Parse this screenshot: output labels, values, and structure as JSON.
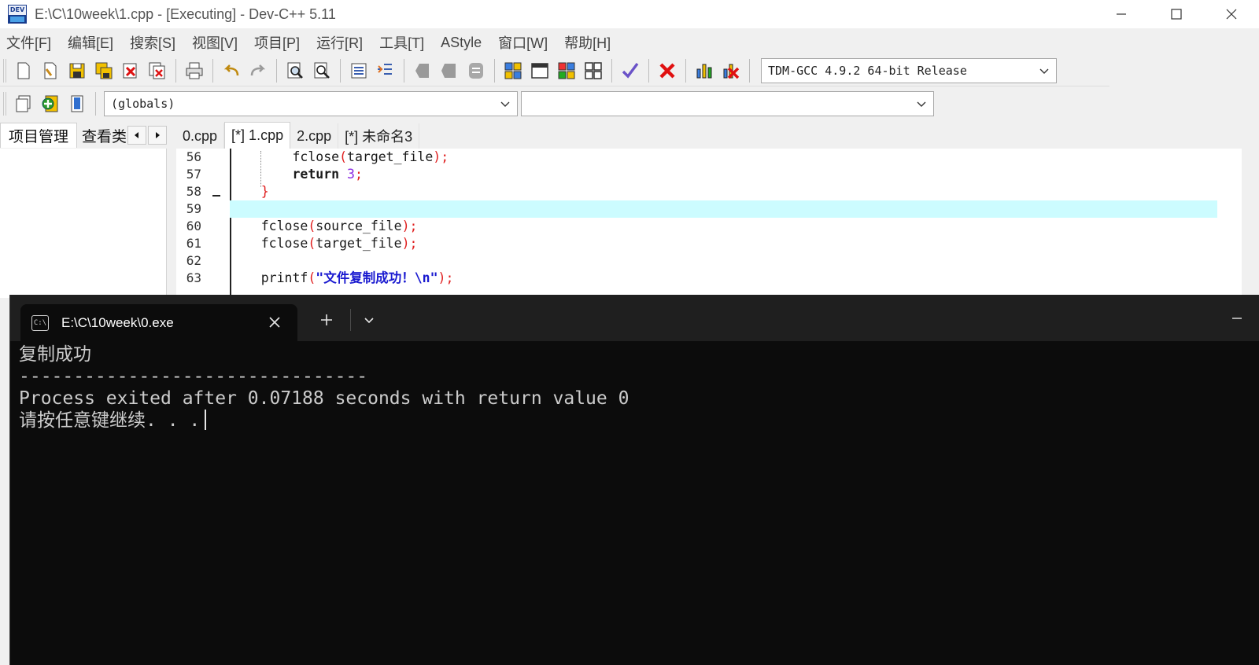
{
  "window": {
    "title": "E:\\C\\10week\\1.cpp - [Executing] - Dev-C++ 5.11",
    "icon_text": "DEV"
  },
  "menu": [
    "文件[F]",
    "编辑[E]",
    "搜索[S]",
    "视图[V]",
    "项目[P]",
    "运行[R]",
    "工具[T]",
    "AStyle",
    "窗口[W]",
    "帮助[H]"
  ],
  "toolbar": {
    "compiler": "TDM-GCC 4.9.2 64-bit Release",
    "globals": "(globals)",
    "members": ""
  },
  "left_panel": {
    "tabs": [
      "项目管理",
      "查看类"
    ]
  },
  "editor": {
    "tabs": [
      "0.cpp",
      "[*] 1.cpp",
      "2.cpp",
      "[*] 未命名3"
    ],
    "active_tab": 1,
    "lines": [
      {
        "n": "56",
        "text": "        fclose(target_file);"
      },
      {
        "n": "57",
        "text": "        return 3;"
      },
      {
        "n": "58",
        "text": "    }"
      },
      {
        "n": "59",
        "text": "",
        "highlight": true
      },
      {
        "n": "60",
        "text": "    fclose(source_file);"
      },
      {
        "n": "61",
        "text": "    fclose(target_file);"
      },
      {
        "n": "62",
        "text": ""
      },
      {
        "n": "63",
        "text": "    printf(\"文件复制成功！\\n\");"
      }
    ]
  },
  "terminal": {
    "tab_title": "E:\\C\\10week\\0.exe",
    "icon_text": "C:\\",
    "lines": [
      "复制成功",
      "--------------------------------",
      "Process exited after 0.07188 seconds with return value 0",
      "请按任意键继续. . ."
    ]
  }
}
